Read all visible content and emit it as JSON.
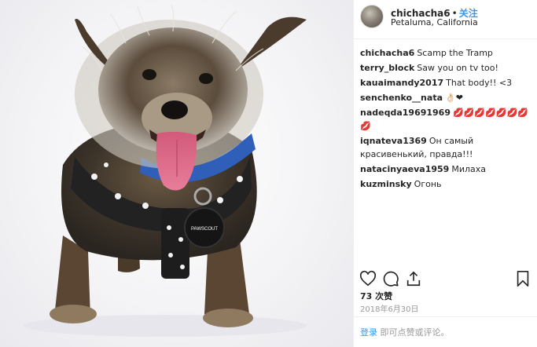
{
  "post": {
    "username": "chichacha6",
    "separator": "•",
    "follow_label": "关注",
    "location": "Petaluma, California"
  },
  "comments": [
    {
      "user": "chichacha6",
      "text": "Scamp the Tramp"
    },
    {
      "user": "terry_block",
      "text": "Saw you on tv too!"
    },
    {
      "user": "kauaimandy2017",
      "text": "That body!! <3"
    },
    {
      "user": "senchenko__nata",
      "text": "👌🏻❤"
    },
    {
      "user": "nadeqda19691969",
      "text": "💋💋💋💋💋💋💋💋"
    },
    {
      "user": "iqnateva1369",
      "text": "Он самый красивенький, правда!!!"
    },
    {
      "user": "natacinyaeva1959",
      "text": "Милаха"
    },
    {
      "user": "kuzminsky",
      "text": "Огонь"
    }
  ],
  "likes_text": "73 次赞",
  "date_text": "2018年6月30日",
  "footer": {
    "login_link": "登录",
    "login_rest": " 即可点赞或评论。"
  },
  "photo": {
    "tag_text": "PAWSCOUT"
  },
  "colors": {
    "link": "#3897f0",
    "muted": "#999999",
    "text": "#262626"
  },
  "icons": [
    "heart-icon",
    "comment-icon",
    "share-icon",
    "bookmark-icon"
  ]
}
